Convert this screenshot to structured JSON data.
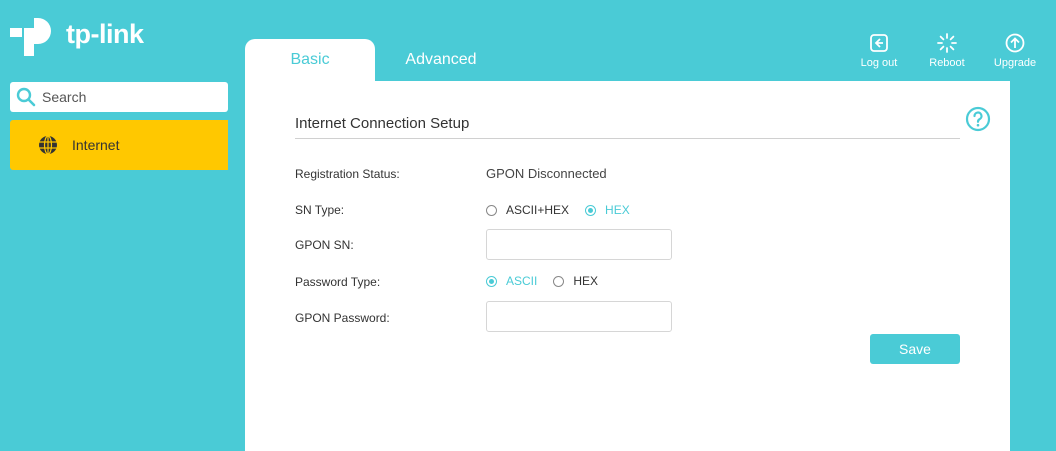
{
  "brand": {
    "name": "tp-link"
  },
  "search": {
    "placeholder": "Search"
  },
  "sidebar": {
    "items": [
      {
        "label": "Internet",
        "icon": "globe-icon",
        "active": true
      }
    ]
  },
  "tabs": [
    {
      "label": "Basic",
      "active": true
    },
    {
      "label": "Advanced",
      "active": false
    }
  ],
  "toolbar": {
    "logout_label": "Log out",
    "reboot_label": "Reboot",
    "upgrade_label": "Upgrade"
  },
  "section": {
    "title": "Internet Connection Setup",
    "fields": {
      "registration_status": {
        "label": "Registration Status:",
        "value": "GPON Disconnected"
      },
      "sn_type": {
        "label": "SN Type:",
        "options": [
          "ASCII+HEX",
          "HEX"
        ],
        "selected": "HEX"
      },
      "gpon_sn": {
        "label": "GPON SN:",
        "value": ""
      },
      "password_type": {
        "label": "Password Type:",
        "options": [
          "ASCII",
          "HEX"
        ],
        "selected": "ASCII"
      },
      "gpon_password": {
        "label": "GPON Password:",
        "value": ""
      }
    },
    "save_label": "Save"
  },
  "colors": {
    "accent": "#4acbd6",
    "nav_active": "#ffc800"
  }
}
